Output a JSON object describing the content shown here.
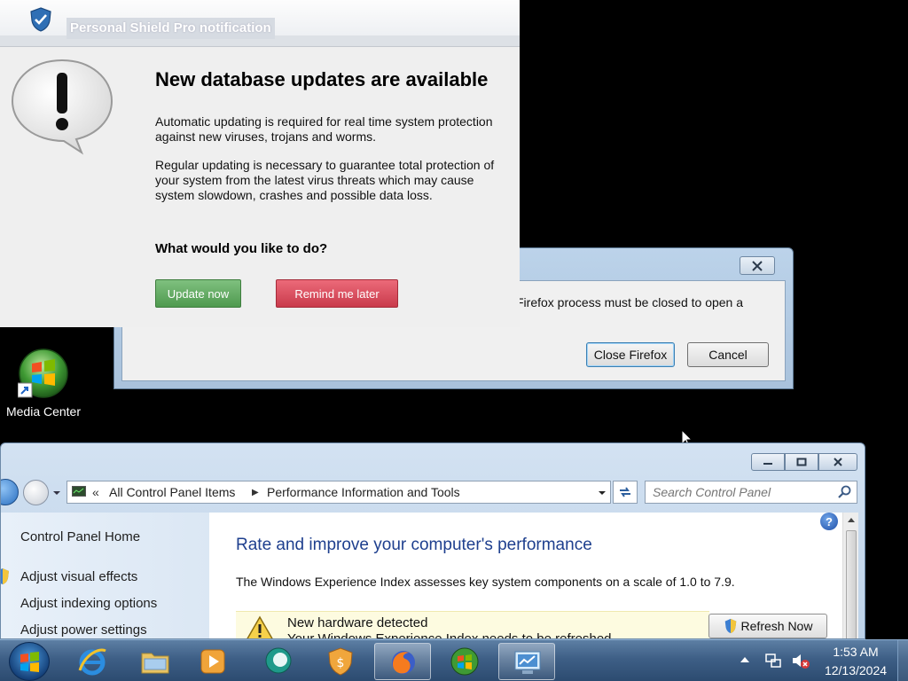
{
  "av_popup": {
    "title": "Personal Shield Pro notification",
    "heading": "New database updates are available",
    "paragraph1": "Automatic updating is required for real time system protection against new viruses, trojans and worms.",
    "paragraph2": "Regular updating is necessary to guarantee total protection of your system from the latest virus threats which may cause system slowdown, crashes and possible data loss.",
    "question": "What would you like to do?",
    "update_button": "Update now",
    "remind_button": "Remind me later"
  },
  "firefox_dialog": {
    "message": "Firefox process must be closed to open a",
    "close_firefox_button": "Close Firefox",
    "cancel_button": "Cancel"
  },
  "desktop": {
    "icons": [
      {
        "label": "Media Center",
        "icon": "windows-media-center-icon"
      }
    ]
  },
  "control_panel": {
    "breadcrumb": [
      "All Control Panel Items",
      "Performance Information and Tools"
    ],
    "search_placeholder": "Search Control Panel",
    "sidebar": {
      "home": "Control Panel Home",
      "links": [
        "Adjust visual effects",
        "Adjust indexing options",
        "Adjust power settings"
      ]
    },
    "heading": "Rate and improve your computer's performance",
    "description": "The Windows Experience Index assesses key system components on a scale of 1.0 to 7.9.",
    "notice": {
      "title": "New hardware detected",
      "subtitle": "Your Windows Experience Index needs to be refreshed"
    },
    "refresh_button": "Refresh Now"
  },
  "taskbar": {
    "items": [
      {
        "icon": "internet-explorer-icon",
        "active": false
      },
      {
        "icon": "file-explorer-icon",
        "active": false
      },
      {
        "icon": "media-player-icon",
        "active": false
      },
      {
        "icon": "chat-bubble-icon",
        "active": false
      },
      {
        "icon": "shield-icon",
        "active": false
      },
      {
        "icon": "firefox-icon",
        "active": true
      },
      {
        "icon": "windows-logo-icon",
        "active": false
      },
      {
        "icon": "performance-monitor-icon",
        "active": true
      }
    ],
    "time": "1:53 AM",
    "date": "12/13/2024"
  },
  "colors": {
    "update_button": "#5aa85a",
    "remind_button": "#d94b5b",
    "cp_heading": "#1e3f8e",
    "taskbar": "#3e5f86"
  }
}
